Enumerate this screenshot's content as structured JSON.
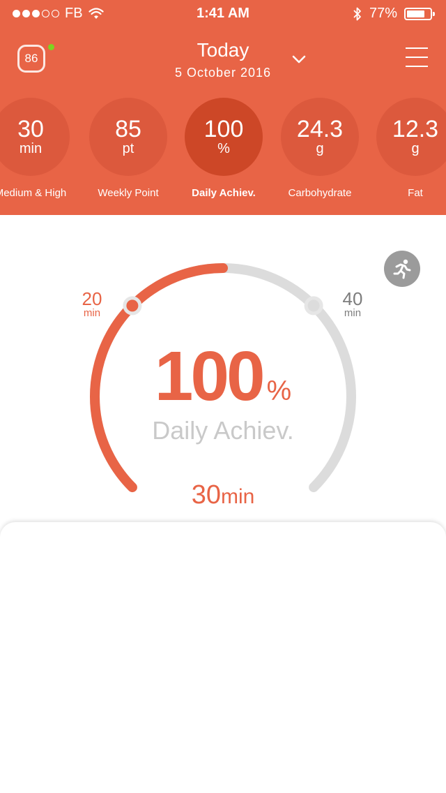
{
  "status_bar": {
    "carrier": "FB",
    "time": "1:41 AM",
    "battery": "77%",
    "battery_level": 0.77,
    "signal_filled": 3,
    "signal_total": 5,
    "icons": [
      "wifi-icon",
      "bluetooth-icon",
      "battery-icon"
    ]
  },
  "header": {
    "score_badge": "86",
    "title": "Today",
    "date": "5 October 2016",
    "accent_color": "#e86446",
    "status_dot_color": "#7ed321"
  },
  "metrics": [
    {
      "value": "30",
      "unit": "min",
      "label": "Medium & High",
      "active": false
    },
    {
      "value": "85",
      "unit": "pt",
      "label": "Weekly Point",
      "active": false
    },
    {
      "value": "100",
      "unit": "%",
      "label": "Daily Achiev.",
      "active": true
    },
    {
      "value": "24.3",
      "unit": "g",
      "label": "Carbohydrate",
      "active": false
    },
    {
      "value": "12.3",
      "unit": "g",
      "label": "Fat",
      "active": false
    }
  ],
  "gauge": {
    "min_value": "20",
    "min_unit": "min",
    "max_value": "40",
    "max_unit": "min",
    "value": "100",
    "value_unit": "%",
    "caption": "Daily Achiev.",
    "minutes_value": "30",
    "minutes_unit": "min",
    "progress_fraction": 0.5,
    "fill_color": "#e86446",
    "track_color": "#dcdcdc"
  }
}
